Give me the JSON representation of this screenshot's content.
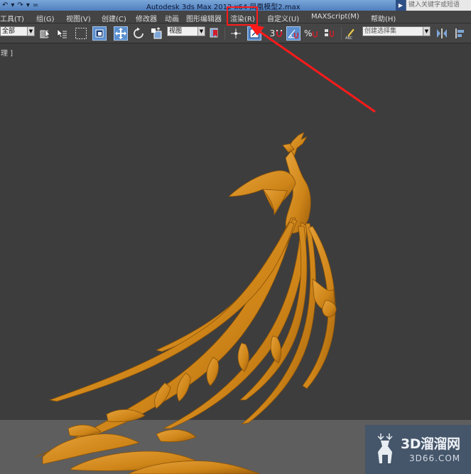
{
  "titlebar": {
    "quick_access": [
      "↶",
      "▾",
      "↷",
      "▾",
      "="
    ],
    "title": "Autodesk 3ds Max  2012 x64      凤凰模型2.max",
    "search_placeholder": "键入关键字或短语"
  },
  "menubar": {
    "items": [
      {
        "label": "工具(T)"
      },
      {
        "label": "组(G)"
      },
      {
        "label": "视图(V)"
      },
      {
        "label": "创建(C)"
      },
      {
        "label": "修改器"
      },
      {
        "label": "动画"
      },
      {
        "label": "图形编辑器"
      },
      {
        "label": "渲染(R)"
      },
      {
        "label": "自定义(U)"
      },
      {
        "label": "MAXScript(M)"
      },
      {
        "label": "帮助(H)"
      }
    ]
  },
  "toolbar": {
    "selection_filter": "全部",
    "reference_coord": "视图",
    "snap_value": "3",
    "named_selection_placeholder": "创建选择集"
  },
  "viewport": {
    "label": "理 ]"
  },
  "watermark": {
    "brand": "3D溜溜网",
    "domain": "3D66.COM"
  },
  "colors": {
    "model": "#d48a20",
    "annotation": "#ff1a1a",
    "active_button": "#5b8fcf"
  }
}
